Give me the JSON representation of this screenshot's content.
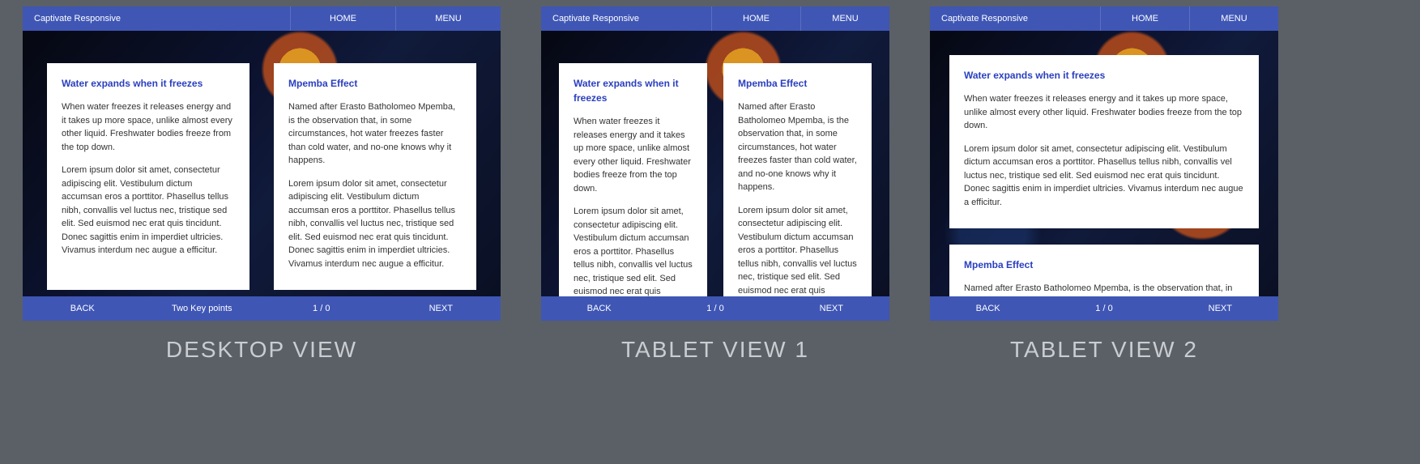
{
  "app": {
    "brand": "Captivate Responsive"
  },
  "nav": {
    "home": "HOME",
    "menu": "MENU"
  },
  "cards": {
    "water": {
      "title": "Water expands when it freezes",
      "p1": "When water freezes it releases energy and it takes up more space,  unlike almost every other liquid. Freshwater bodies freeze from the top down.",
      "p2": "Lorem ipsum dolor sit amet, consectetur adipiscing elit. Vestibulum dictum accumsan eros a porttitor. Phasellus tellus nibh, convallis vel luctus nec, tristique sed elit. Sed euismod nec erat quis tincidunt. Donec sagittis enim in imperdiet ultricies. Vivamus interdum nec augue a efficitur."
    },
    "mpemba": {
      "title": "Mpemba Effect",
      "p1": "Named after Erasto Batholomeo Mpemba, is the observation that, in some circumstances, hot water freezes faster than cold water, and no-one knows why it happens.",
      "p2": "Lorem ipsum dolor sit amet, consectetur adipiscing elit. Vestibulum dictum accumsan eros a porttitor. Phasellus tellus nibh, convallis vel luctus nec, tristique sed elit. Sed euismod nec erat quis tincidunt. Donec sagittis enim in imperdiet ultricies. Vivamus interdum nec augue a efficitur."
    }
  },
  "footer": {
    "back": "BACK",
    "subtitle": "Two Key points",
    "pager": "1 / 0",
    "next": "NEXT"
  },
  "captions": {
    "desktop": "DESKTOP VIEW",
    "tablet1": "TABLET VIEW 1",
    "tablet2": "TABLET VIEW 2"
  }
}
